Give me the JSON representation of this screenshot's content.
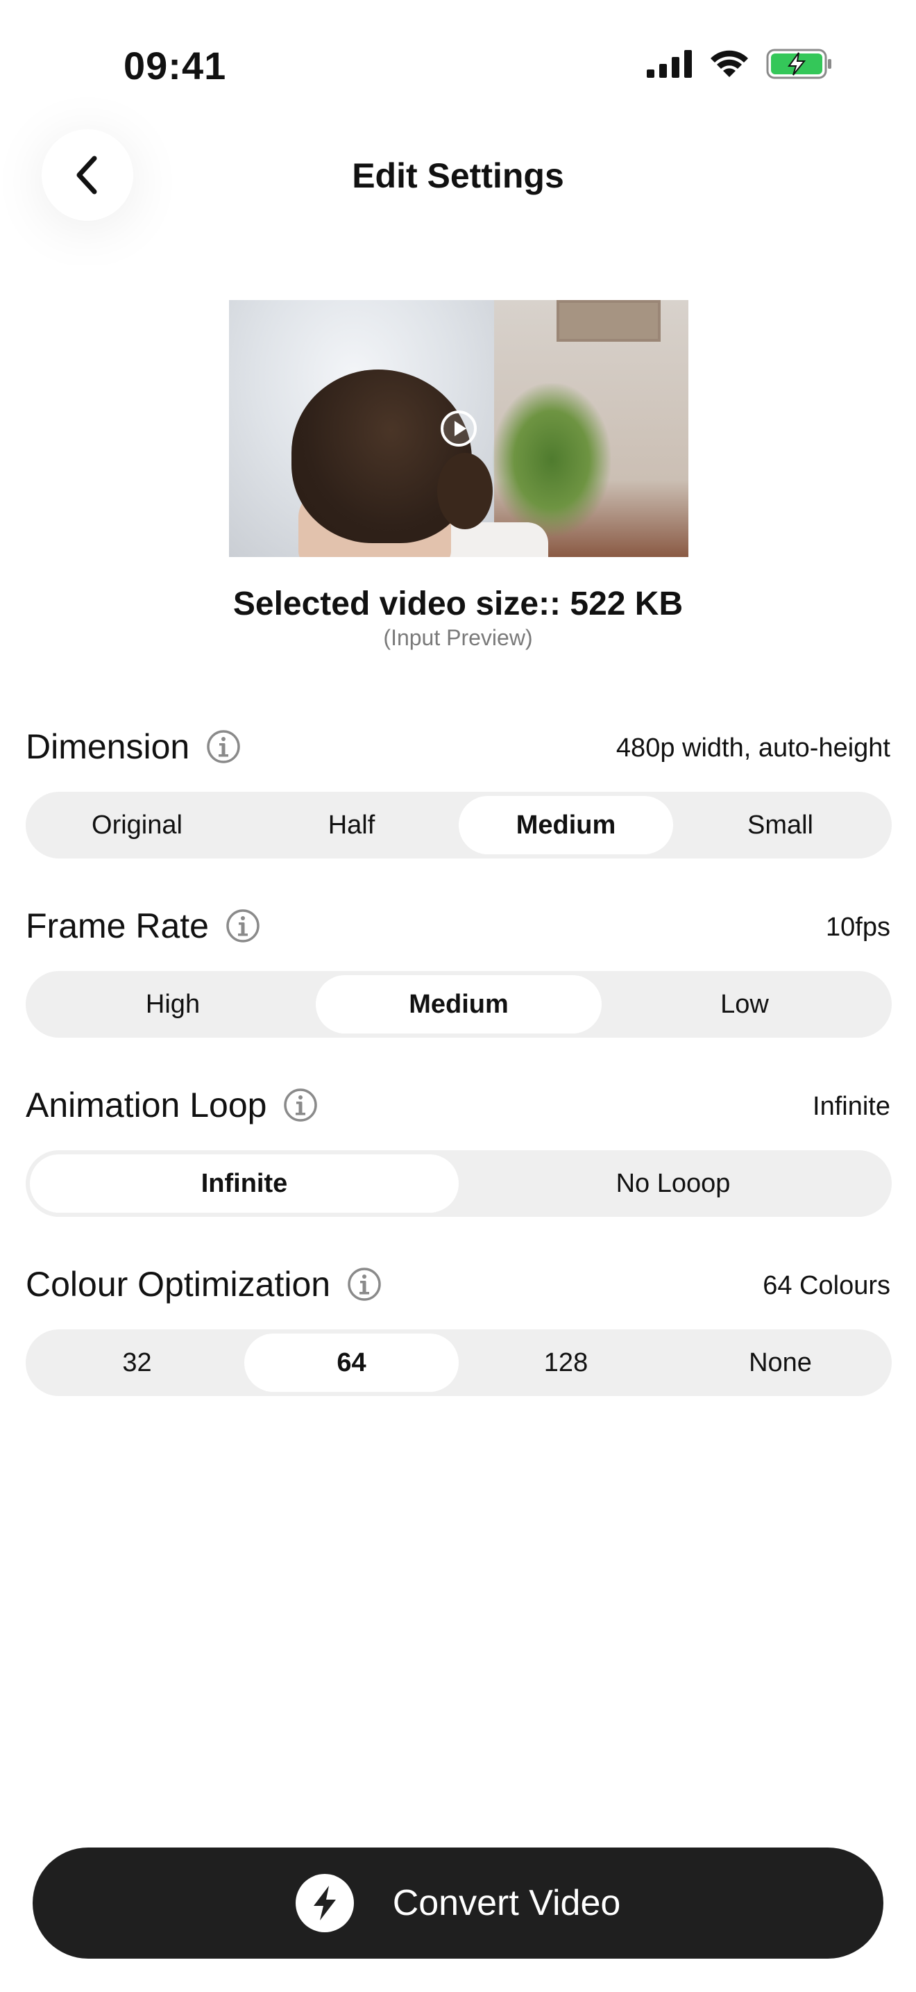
{
  "status_bar": {
    "time": "09:41"
  },
  "header": {
    "title": "Edit Settings"
  },
  "preview": {
    "size_text": "Selected video size:: 522 KB",
    "caption": "(Input Preview)"
  },
  "dimension": {
    "label": "Dimension",
    "value": "480p width, auto-height",
    "options": [
      "Original",
      "Half",
      "Medium",
      "Small"
    ],
    "selected": "Medium"
  },
  "frame_rate": {
    "label": "Frame Rate",
    "value": "10fps",
    "options": [
      "High",
      "Medium",
      "Low"
    ],
    "selected": "Medium"
  },
  "animation_loop": {
    "label": "Animation Loop",
    "value": "Infinite",
    "options": [
      "Infinite",
      "No Looop"
    ],
    "selected": "Infinite"
  },
  "colour_optimization": {
    "label": "Colour Optimization",
    "value": "64 Colours",
    "options": [
      "32",
      "64",
      "128",
      "None"
    ],
    "selected": "64"
  },
  "action": {
    "convert_label": "Convert Video"
  },
  "icons": {
    "back": "chevron-left-icon",
    "play": "play-circle-icon",
    "info": "info-icon",
    "bolt": "lightning-bolt-icon",
    "signal": "cellular-signal-icon",
    "wifi": "wifi-icon",
    "battery": "battery-charging-icon"
  },
  "colors": {
    "battery_fill": "#34c759",
    "button_bg": "#1f1f1f",
    "segment_bg": "#efefef"
  }
}
